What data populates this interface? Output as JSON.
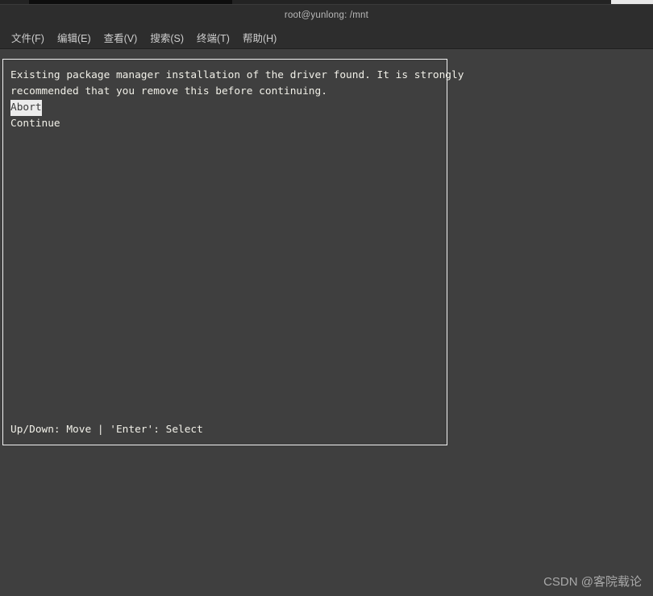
{
  "window": {
    "title": "root@yunlong: /mnt",
    "background_color": "#3f3f3f",
    "titlebar_color": "#2d2d2d"
  },
  "menubar": {
    "items": [
      {
        "label": "文件(F)",
        "name": "menu-file"
      },
      {
        "label": "编辑(E)",
        "name": "menu-edit"
      },
      {
        "label": "查看(V)",
        "name": "menu-view"
      },
      {
        "label": "搜索(S)",
        "name": "menu-search"
      },
      {
        "label": "终端(T)",
        "name": "menu-terminal"
      },
      {
        "label": "帮助(H)",
        "name": "menu-help"
      }
    ]
  },
  "terminal": {
    "dialog": {
      "border_color": "#f2f2f2",
      "message_line_1": "Existing package manager installation of the driver found. It is strongly",
      "message_line_2": "recommended that you remove this before continuing.",
      "options": [
        {
          "label": "Abort",
          "selected": true
        },
        {
          "label": "Continue",
          "selected": false
        }
      ],
      "footer_hint": "Up/Down: Move | 'Enter': Select",
      "selected_bg": "#ececec",
      "selected_fg": "#3a3a3a",
      "text_color": "#f1f0e8"
    }
  },
  "watermark": {
    "text": "CSDN @客院载论"
  }
}
